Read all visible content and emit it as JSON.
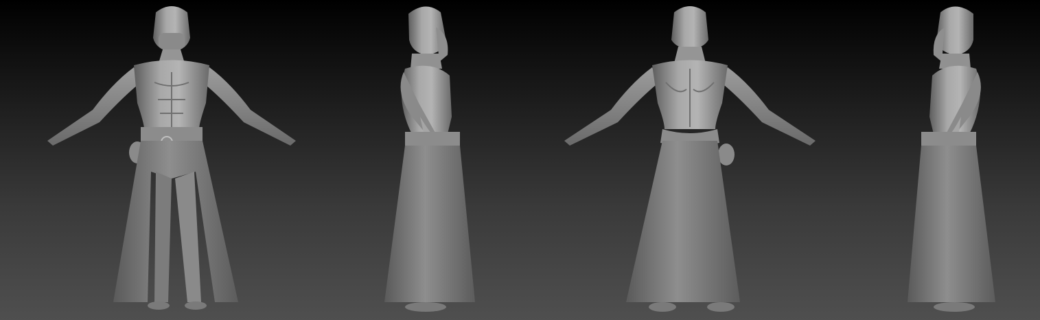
{
  "scene": {
    "description_free": true,
    "background_top_color": "#000000",
    "background_bottom_color": "#4f4f4f",
    "material_color": "#9a9a9a"
  },
  "views": [
    {
      "id": "front",
      "icon": "figure-front"
    },
    {
      "id": "side-right",
      "icon": "figure-side"
    },
    {
      "id": "back",
      "icon": "figure-back"
    },
    {
      "id": "side-left",
      "icon": "figure-side"
    }
  ]
}
